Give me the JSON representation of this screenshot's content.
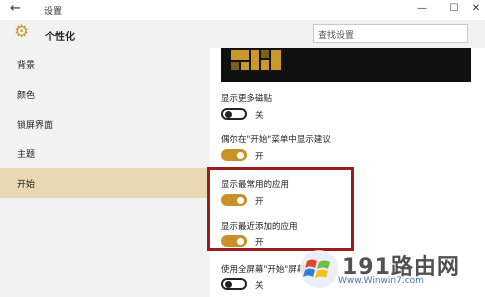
{
  "window": {
    "title": "设置",
    "back_icon": "back-arrow-icon",
    "controls": [
      "minimize-icon",
      "maximize-icon",
      "close-icon"
    ]
  },
  "header": {
    "icon": "gear-icon",
    "title": "个性化",
    "search_placeholder": "查找设置"
  },
  "sidebar": {
    "items": [
      {
        "label": "背景",
        "active": false
      },
      {
        "label": "颜色",
        "active": false
      },
      {
        "label": "锁屏界面",
        "active": false
      },
      {
        "label": "主题",
        "active": false
      },
      {
        "label": "开始",
        "active": true
      }
    ]
  },
  "settings": [
    {
      "label": "显示更多磁贴",
      "state": "关",
      "on": false
    },
    {
      "label": "偶尔在\"开始\"菜单中显示建议",
      "state": "开",
      "on": true
    },
    {
      "label": "显示最常用的应用",
      "state": "开",
      "on": true
    },
    {
      "label": "显示最近添加的应用",
      "state": "开",
      "on": true
    },
    {
      "label": "使用全屏幕\"开始\"屏幕",
      "state": "关",
      "on": false
    }
  ],
  "watermark": {
    "text": "191路由网",
    "url": "Www.Winwin7.com"
  },
  "colors": {
    "accent": "#c8922a",
    "highlight_frame": "#9c1b1b",
    "sidebar_bg": "#f2f2f2",
    "active_item_bg": "#e8d9b4"
  }
}
